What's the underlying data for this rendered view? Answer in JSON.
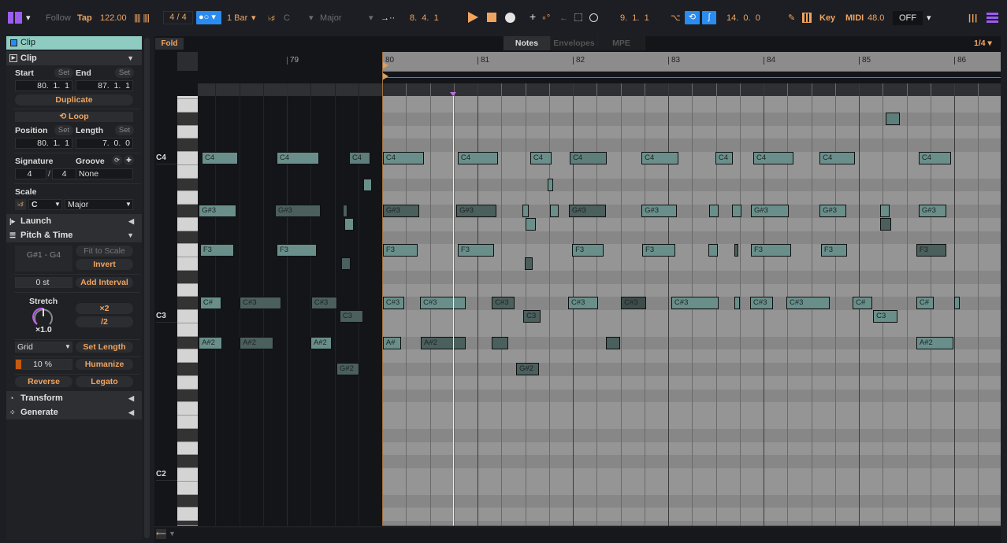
{
  "topbar": {
    "follow": "Follow",
    "tap": "Tap",
    "tempo": "122.00",
    "signature": "4 / 4",
    "quantize": "1 Bar",
    "scale_root": "C",
    "scale_mode": "Major",
    "arrangement_position": "8.  4.  1",
    "loop_start": "9.  1.  1",
    "loop_length": "14.  0.  0",
    "key": "Key",
    "midi": "MIDI",
    "cpu": "48.0",
    "output": "OFF",
    "accent": "#f0a460",
    "blue": "#2a8bf0",
    "purple": "#9b5cf0"
  },
  "clip_panel": {
    "header": "Clip",
    "section": "Clip",
    "start_label": "Start",
    "end_label": "End",
    "set": "Set",
    "start": "80.  1.  1",
    "end": "87.  1.  1",
    "duplicate": "Duplicate",
    "loop": "Loop",
    "position_label": "Position",
    "length_label": "Length",
    "position": "80.  1.  1",
    "length": "7.  0.  0",
    "signature_label": "Signature",
    "groove_label": "Groove",
    "sig_num": "4",
    "sig_den": "4",
    "sig_sep": "/",
    "groove": "None",
    "scale_label": "Scale",
    "scale_root": "C",
    "scale_mode": "Major",
    "launch": "Launch",
    "pitch_time": "Pitch & Time",
    "range": "G#1 - G4",
    "fit_to_scale": "Fit to Scale",
    "invert": "Invert",
    "transpose": "0 st",
    "add_interval": "Add Interval",
    "stretch_label": "Stretch",
    "stretch_value": "×1.0",
    "double": "×2",
    "half": "/2",
    "grid": "Grid",
    "set_length": "Set Length",
    "humanize_amount": "10 %",
    "humanize_fraction": 0.1,
    "humanize": "Humanize",
    "reverse": "Reverse",
    "legato": "Legato",
    "transform": "Transform",
    "generate": "Generate"
  },
  "editor": {
    "fold": "Fold",
    "tabs": [
      "Notes",
      "Envelopes",
      "MPE"
    ],
    "grid_value": "1/4",
    "bars": [
      "79",
      "80",
      "81",
      "82",
      "83",
      "84",
      "85",
      "86"
    ],
    "octave_labels": [
      "C4",
      "C3",
      "C2"
    ],
    "loop_start_bar": 80,
    "playhead_beat": 10.98
  },
  "notes": [
    [
      "C4",
      60,
      0.43,
      1.52,
      0
    ],
    [
      "C4",
      60,
      3.57,
      1.79,
      0
    ],
    [
      "C4",
      60,
      6.61,
      0.89,
      1
    ],
    [
      "C4",
      60,
      8.03,
      1.72,
      0
    ],
    [
      "C4",
      60,
      11.17,
      1.69,
      0
    ],
    [
      "C4",
      60,
      14.21,
      0.89,
      0
    ],
    [
      "C4",
      60,
      15.87,
      1.55,
      1
    ],
    [
      "C4",
      60,
      18.88,
      1.55,
      0
    ],
    [
      "C4",
      60,
      21.98,
      0.73,
      0
    ],
    [
      "C4",
      60,
      23.57,
      1.69,
      0
    ],
    [
      "C4",
      60,
      26.35,
      1.49,
      0
    ],
    [
      "C4",
      60,
      30.51,
      1.36,
      0
    ],
    [
      "",
      63,
      29.12,
      0.6,
      1
    ],
    [
      "",
      58,
      7.21,
      0.36,
      0
    ],
    [
      "",
      58,
      14.94,
      0.25,
      0
    ],
    [
      "G#3",
      56,
      0.3,
      1.59,
      0
    ],
    [
      "G#3",
      56,
      3.5,
      1.92,
      2
    ],
    [
      "",
      56,
      6.35,
      0.2,
      2
    ],
    [
      "G#3",
      56,
      8.03,
      1.52,
      2
    ],
    [
      "G#3",
      56,
      11.11,
      1.69,
      2
    ],
    [
      "",
      56,
      13.88,
      0.27,
      0
    ],
    [
      "",
      56,
      15.04,
      0.36,
      0
    ],
    [
      "G#3",
      56,
      15.83,
      1.55,
      2
    ],
    [
      "G#3",
      56,
      18.88,
      1.49,
      0
    ],
    [
      "",
      56,
      21.72,
      0.4,
      0
    ],
    [
      "",
      56,
      22.68,
      0.4,
      0
    ],
    [
      "G#3",
      56,
      23.47,
      1.59,
      0
    ],
    [
      "G#3",
      56,
      26.35,
      1.12,
      0
    ],
    [
      "",
      56,
      28.89,
      0.4,
      0
    ],
    [
      "G#3",
      56,
      30.51,
      1.16,
      0
    ],
    [
      "",
      55,
      6.41,
      0.4,
      0
    ],
    [
      "",
      55,
      14.02,
      0.43,
      0
    ],
    [
      "",
      55,
      28.89,
      0.46,
      2
    ],
    [
      "F3",
      53,
      0.36,
      1.42,
      0
    ],
    [
      "F3",
      53,
      3.57,
      1.69,
      0
    ],
    [
      "F3",
      53,
      8.03,
      1.45,
      0
    ],
    [
      "F3",
      53,
      11.17,
      1.52,
      0
    ],
    [
      "F3",
      53,
      15.97,
      1.32,
      0
    ],
    [
      "F3",
      53,
      18.91,
      1.39,
      0
    ],
    [
      "",
      53,
      21.69,
      0.4,
      0
    ],
    [
      "",
      53,
      22.78,
      0.13,
      2
    ],
    [
      "F3",
      53,
      23.47,
      1.69,
      0
    ],
    [
      "F3",
      53,
      26.41,
      1.09,
      0
    ],
    [
      "F3",
      53,
      30.41,
      1.26,
      2
    ],
    [
      "",
      52,
      6.28,
      0.4,
      2
    ],
    [
      "",
      52,
      13.98,
      0.33,
      2
    ],
    [
      "C#",
      49,
      0.36,
      0.89,
      0
    ],
    [
      "C#3",
      49,
      2.02,
      1.75,
      2
    ],
    [
      "C#3",
      49,
      5.02,
      1.09,
      2
    ],
    [
      "C#3",
      49,
      8.03,
      0.89,
      0
    ],
    [
      "C#3",
      49,
      9.59,
      1.92,
      0
    ],
    [
      "C#3",
      49,
      12.6,
      0.96,
      2
    ],
    [
      "C#3",
      49,
      15.8,
      1.26,
      0
    ],
    [
      "C#3",
      49,
      18.02,
      1.06,
      3
    ],
    [
      "C#3",
      49,
      20.13,
      1.98,
      0
    ],
    [
      "",
      49,
      22.78,
      0.23,
      0
    ],
    [
      "C#3",
      49,
      23.44,
      0.96,
      0
    ],
    [
      "C#3",
      49,
      24.96,
      1.82,
      0
    ],
    [
      "C#",
      49,
      27.74,
      0.83,
      0
    ],
    [
      "C#",
      49,
      30.41,
      0.73,
      0
    ],
    [
      "",
      49,
      32.0,
      0.23,
      0
    ],
    [
      "C3",
      48,
      6.21,
      0.99,
      2
    ],
    [
      "C3",
      48,
      13.92,
      0.73,
      2
    ],
    [
      "C3",
      48,
      28.6,
      1.02,
      0
    ],
    [
      "A#2",
      46,
      0.3,
      0.99,
      0
    ],
    [
      "A#2",
      46,
      2.02,
      1.42,
      2
    ],
    [
      "A#2",
      46,
      4.99,
      0.89,
      0
    ],
    [
      "A#",
      46,
      8.03,
      0.76,
      0
    ],
    [
      "A#2",
      46,
      9.62,
      1.88,
      2
    ],
    [
      "",
      46,
      12.6,
      0.69,
      2
    ],
    [
      "",
      46,
      17.39,
      0.6,
      2
    ],
    [
      "A#2",
      46,
      30.41,
      1.55,
      0
    ],
    [
      "G#2",
      44,
      6.08,
      0.96,
      2
    ],
    [
      "G#2",
      44,
      13.62,
      0.96,
      2
    ]
  ]
}
